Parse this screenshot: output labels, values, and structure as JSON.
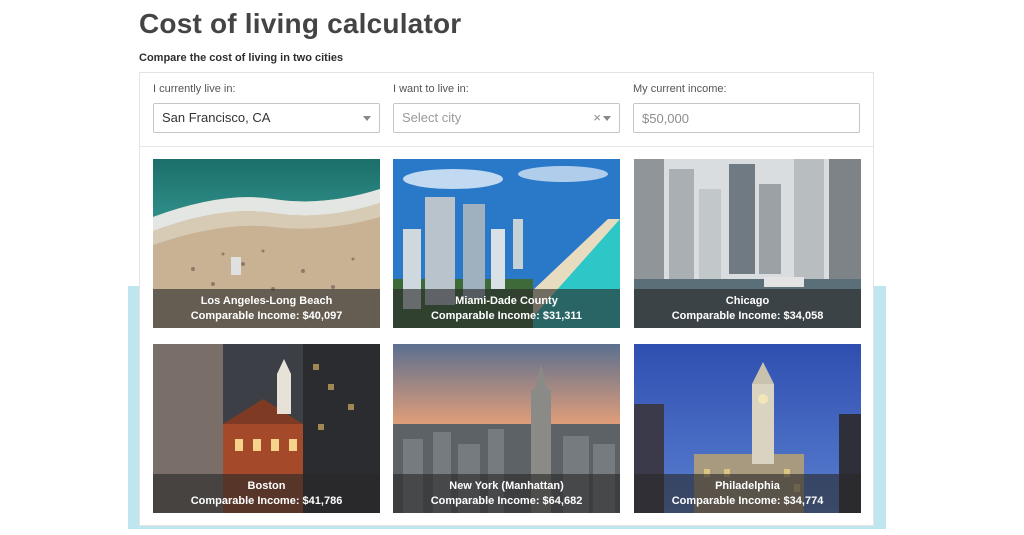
{
  "page": {
    "title": "Cost of living calculator",
    "subtitle": "Compare the cost of living in two cities"
  },
  "form": {
    "current_city": {
      "label": "I currently live in:",
      "value": "San Francisco, CA"
    },
    "target_city": {
      "label": "I want to live in:",
      "placeholder": "Select city",
      "clear_icon": "×"
    },
    "income": {
      "label": "My current income:",
      "placeholder": "$50,000"
    }
  },
  "cities": [
    {
      "name": "Los Angeles-Long Beach",
      "income_text": "Comparable Income: $40,097",
      "photo": "beach-aerial"
    },
    {
      "name": "Miami-Dade County",
      "income_text": "Comparable Income: $31,311",
      "photo": "coastal-skyline"
    },
    {
      "name": "Chicago",
      "income_text": "Comparable Income: $34,058",
      "photo": "river-skyscrapers"
    },
    {
      "name": "Boston",
      "income_text": "Comparable Income: $41,786",
      "photo": "historic-building"
    },
    {
      "name": "New York (Manhattan)",
      "income_text": "Comparable Income: $64,682",
      "photo": "sunset-skyline"
    },
    {
      "name": "Philadelphia",
      "income_text": "Comparable Income: $34,774",
      "photo": "city-hall-tower"
    }
  ],
  "colors": {
    "accent_band": "#bfe6ee",
    "title": "#444444",
    "caption_overlay": "rgba(40,40,40,0.62)"
  }
}
